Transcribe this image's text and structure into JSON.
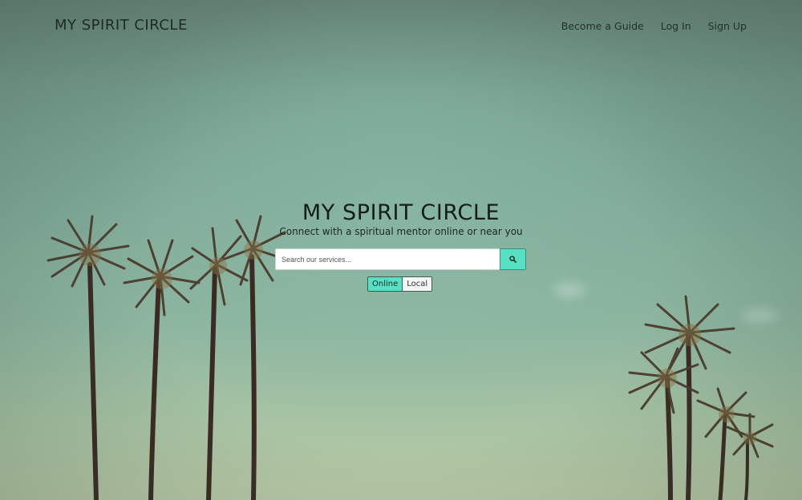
{
  "header": {
    "brand": "MY SPIRIT CIRCLE",
    "nav": [
      {
        "label": "Become a Guide"
      },
      {
        "label": "Log In"
      },
      {
        "label": "Sign Up"
      }
    ]
  },
  "hero": {
    "title": "MY SPIRIT CIRCLE",
    "subtitle": "Connect with a spiritual mentor online or near you"
  },
  "search": {
    "placeholder": "Search our services...",
    "value": "",
    "button_icon": "search-icon"
  },
  "mode_toggle": {
    "options": [
      "Online",
      "Local"
    ],
    "selected": "Online"
  },
  "colors": {
    "accent": "#58e0c4"
  }
}
